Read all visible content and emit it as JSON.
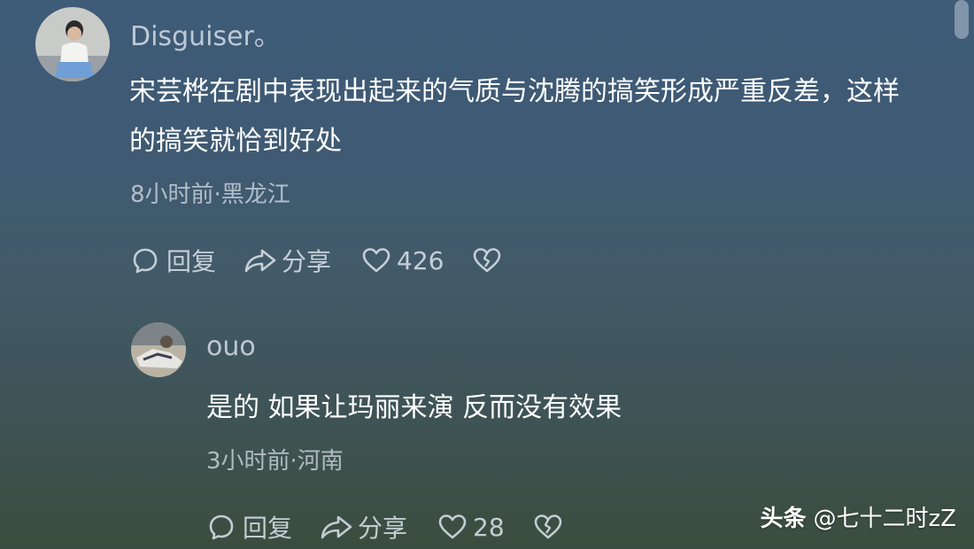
{
  "comments": [
    {
      "username": "Disguiser。",
      "avatar_icon": "user-avatar-photo",
      "content": "宋芸桦在剧中表现出起来的气质与沈腾的搞笑形成严重反差，这样的搞笑就恰到好处",
      "meta": "8小时前·黑龙江",
      "reply_label": "回复",
      "share_label": "分享",
      "likes": "426"
    },
    {
      "username": "ouo",
      "avatar_icon": "user-avatar-photo",
      "content": "是的 如果让玛丽来演 反而没有效果",
      "meta": "3小时前·河南",
      "reply_label": "回复",
      "share_label": "分享",
      "likes": "28"
    }
  ],
  "watermark": {
    "brand": "头条",
    "handle": "@七十二时zZ"
  },
  "colors": {
    "background_top": "#3e5b78",
    "background_bottom": "#3b4d3e",
    "text_primary": "#ffffff",
    "text_secondary": "#dce4ec"
  }
}
